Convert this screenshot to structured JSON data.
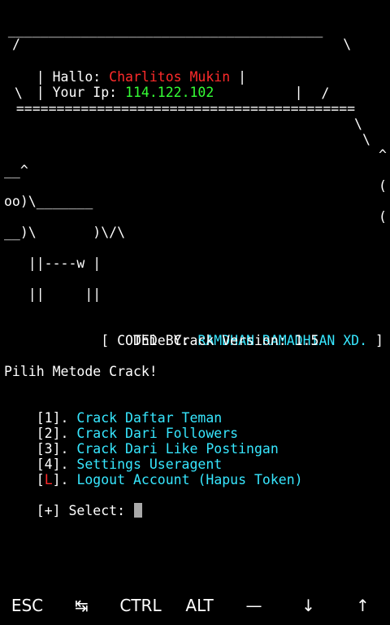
{
  "banner": {
    "top": " _______________________________________",
    "slash_line": "/                                        \\",
    "hallo_label": "| Hallo: ",
    "name": "Charlitos Mukin",
    "hallo_end": " |",
    "ip_label": "| Your Ip: ",
    "ip": "114.122.102",
    "ip_end": "          |",
    "back_slash_line": " \\                                     /",
    "double_line": "  =========================================="
  },
  "ascii_art": {
    "l1": "\\",
    "l2": "\\",
    "l3": "^",
    "l4": "__^",
    "l5": "(",
    "l6": "oo)\\_______",
    "l7": "(",
    "l8": "__)\\       )\\/\\",
    "l9": "   ||----w |",
    "l10": "   ||     ||"
  },
  "credits": {
    "coded_prefix": "        [ CODED BY: ",
    "coded_name": "RAMDHAN RAMADHIAN XD.",
    "coded_suffix": " ]",
    "version_line": "                Thie Crack Version: 1.5"
  },
  "menu": {
    "prompt": "Pilih Metode Crack!",
    "items": [
      {
        "prefix": "[1]. ",
        "label": "Crack Daftar Teman"
      },
      {
        "prefix": "[2]. ",
        "label": "Crack Dari Followers"
      },
      {
        "prefix": "[3]. ",
        "label": "Crack Dari Like Postingan"
      },
      {
        "prefix": "[4]. ",
        "label": "Settings Useragent"
      }
    ],
    "logout": {
      "open": "[",
      "key": "L",
      "close": "]. ",
      "label": "Logout Account (Hapus Token)"
    }
  },
  "input": {
    "prompt": "[+] Select: "
  },
  "keybar": {
    "esc": "ESC",
    "tab_icon": "tab-icon",
    "tab": "↹",
    "ctrl": "CTRL",
    "alt": "ALT",
    "dash": "—",
    "down": "↓",
    "up": "↑"
  },
  "colors": {
    "background": "#000000",
    "red": "#ff2b2b",
    "green": "#35ff35",
    "cyan": "#37e7ff",
    "white": "#ffffff"
  }
}
